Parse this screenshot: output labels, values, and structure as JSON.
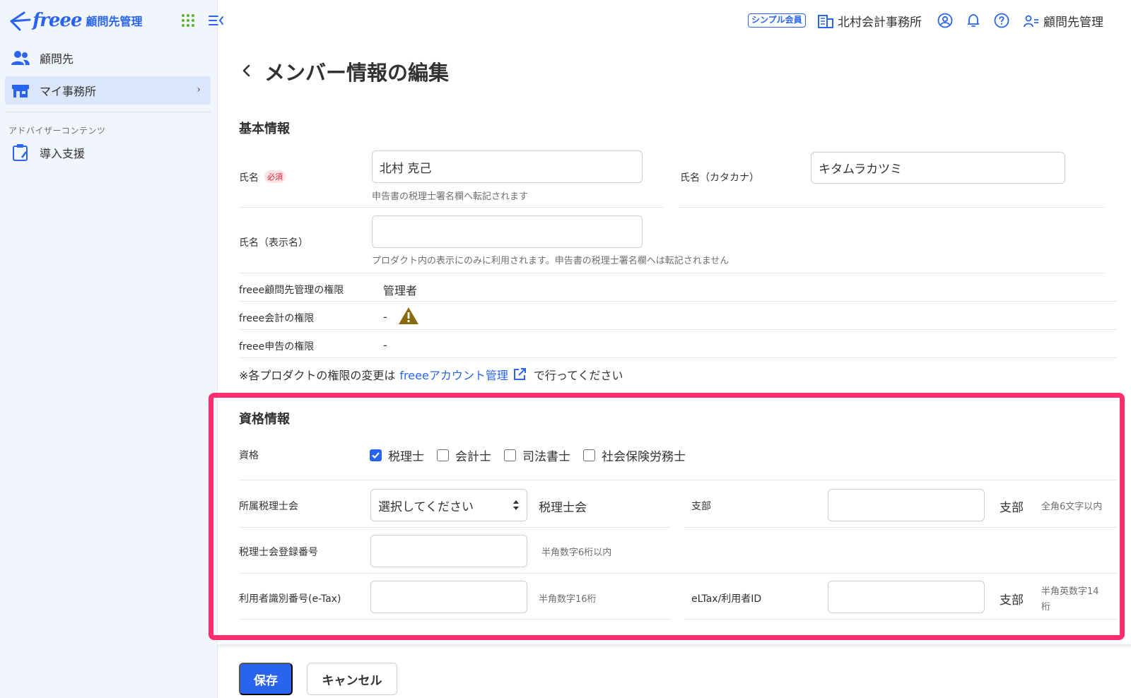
{
  "app": {
    "logo_word": "freee",
    "logo_sub": "顧問先管理"
  },
  "sidebar": {
    "items": [
      {
        "label": "顧問先",
        "icon": "people-icon"
      },
      {
        "label": "マイ事務所",
        "icon": "office-icon",
        "chevron": "›"
      }
    ],
    "section_label": "アドバイザーコンテンツ",
    "section_items": [
      {
        "label": "導入支援",
        "icon": "clipboard-icon"
      }
    ]
  },
  "header": {
    "badge": "シンプル会員",
    "office": "北村会計事務所",
    "user_menu": "顧問先管理"
  },
  "page": {
    "title": "メンバー情報の編集",
    "back": "‹"
  },
  "basic": {
    "title": "基本情報",
    "name_label": "氏名",
    "required_badge": "必須",
    "name_value": "北村 克己",
    "name_hint": "申告書の税理士署名欄へ転記されます",
    "kana_label": "氏名（カタカナ）",
    "kana_value": "キタムラカツミ",
    "display_label": "氏名（表示名）",
    "display_value": "",
    "display_hint": "プロダクト内の表示にのみに利用されます。申告書の税理士署名欄へは転記されません",
    "perm_komon_label": "freee顧問先管理の権限",
    "perm_komon_value": "管理者",
    "perm_kaikei_label": "freee会計の権限",
    "perm_kaikei_value": "-",
    "perm_shinkoku_label": "freee申告の権限",
    "perm_shinkoku_value": "-",
    "note_before": "※各プロダクトの権限の変更は",
    "note_link": "freeeアカウント管理",
    "note_after": "で行ってください"
  },
  "qualification": {
    "title": "資格情報",
    "label": "資格",
    "options": [
      {
        "label": "税理士",
        "checked": true
      },
      {
        "label": "会計士",
        "checked": false
      },
      {
        "label": "司法書士",
        "checked": false
      },
      {
        "label": "社会保険労務士",
        "checked": false
      }
    ],
    "assoc_label": "所属税理士会",
    "assoc_select": "選択してください",
    "assoc_suffix": "税理士会",
    "branch_label": "支部",
    "branch_value": "",
    "branch_suffix": "支部",
    "branch_hint": "全角6文字以内",
    "reg_label": "税理士会登録番号",
    "reg_value": "",
    "reg_hint": "半角数字6桁以内",
    "etax_label": "利用者識別番号(e-Tax)",
    "etax_value": "",
    "etax_hint": "半角数字16桁",
    "eltax_label": "eLTax/利用者ID",
    "eltax_value": "",
    "eltax_suffix": "支部",
    "eltax_hint_1": "半角英数字14",
    "eltax_hint_2": "桁"
  },
  "actions": {
    "save": "保存",
    "cancel": "キャンセル"
  },
  "colors": {
    "brand": "#2864f0",
    "highlight": "#ff2d6e",
    "warning": "#8a6a10"
  }
}
